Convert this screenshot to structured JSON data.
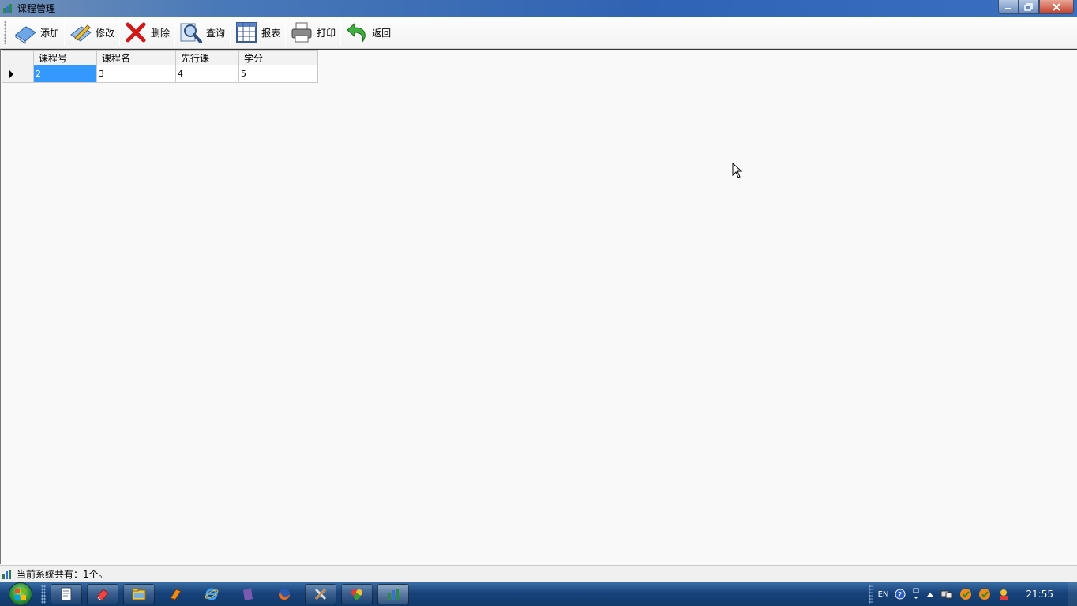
{
  "window": {
    "title": "课程管理"
  },
  "toolbar": {
    "add": "添加",
    "edit": "修改",
    "delete": "删除",
    "query": "查询",
    "report": "报表",
    "print": "打印",
    "back": "返回"
  },
  "grid": {
    "columns": [
      "课程号",
      "课程名",
      "先行课",
      "学分"
    ],
    "rows": [
      [
        "2",
        "3",
        "4",
        "5"
      ]
    ]
  },
  "status": {
    "text": "当前系统共有：1个。"
  },
  "taskbar": {
    "lang": "EN",
    "clock": "21:55"
  },
  "colors": {
    "selection": "#3399ff",
    "titlebar": "#2f63b3"
  }
}
